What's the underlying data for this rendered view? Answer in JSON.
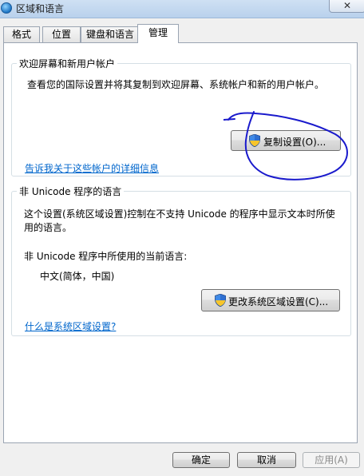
{
  "window": {
    "title": "区域和语言",
    "close_label": "✕"
  },
  "tabs": [
    {
      "label": "格式",
      "active": false
    },
    {
      "label": "位置",
      "active": false
    },
    {
      "label": "键盘和语言",
      "active": false
    },
    {
      "label": "管理",
      "active": true
    }
  ],
  "welcome_group": {
    "title": "欢迎屏幕和新用户帐户",
    "description": "查看您的国际设置并将其复制到欢迎屏幕、系统帐户和新的用户帐户。",
    "copy_button": "复制设置(O)...",
    "link": "告诉我关于这些帐户的详细信息"
  },
  "unicode_group": {
    "title": "非 Unicode 程序的语言",
    "description_line1": "这个设置(系统区域设置)控制在不支持 Unicode 的程序中显示文本时所使",
    "description_line2": "用的语言。",
    "current_label": "非 Unicode 程序中所使用的当前语言:",
    "current_value": "中文(简体，中国)",
    "change_button": "更改系统区域设置(C)...",
    "link": "什么是系统区域设置?"
  },
  "buttons": {
    "ok": "确定",
    "cancel": "取消",
    "apply": "应用(A)"
  },
  "colors": {
    "link": "#0066cc",
    "annotation": "#1a1acc"
  }
}
